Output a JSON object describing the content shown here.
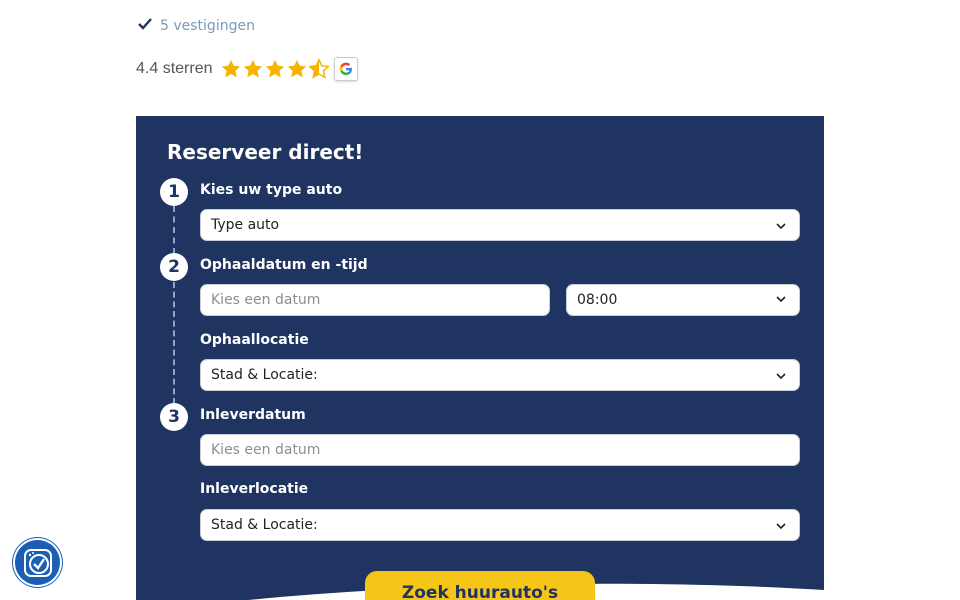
{
  "top": {
    "branches_text": "5 vestigingen",
    "rating_text": "4.4 sterren",
    "rating_value": 4.4,
    "rating_max": 5
  },
  "form": {
    "title": "Reserveer direct!",
    "steps": [
      "1",
      "2",
      "3"
    ],
    "car_type": {
      "label": "Kies uw type auto",
      "value": "Type auto"
    },
    "pickup_datetime": {
      "label": "Ophaaldatum en -tijd",
      "date_placeholder": "Kies een datum",
      "time_value": "08:00"
    },
    "pickup_location": {
      "label": "Ophaallocatie",
      "value": "Stad & Locatie:"
    },
    "return_date": {
      "label": "Inleverdatum",
      "placeholder": "Kies een datum"
    },
    "return_location": {
      "label": "Inleverlocatie",
      "value": "Stad & Locatie:"
    },
    "submit_label": "Zoek huurauto's"
  },
  "colors": {
    "panel": "#1f3460",
    "accent": "#f5c518",
    "star": "#f5b400",
    "accessibility": "#1a5fb4"
  },
  "icons": [
    "check-icon",
    "star-icon",
    "google-icon",
    "chevron-down-icon",
    "accessibility-icon"
  ]
}
